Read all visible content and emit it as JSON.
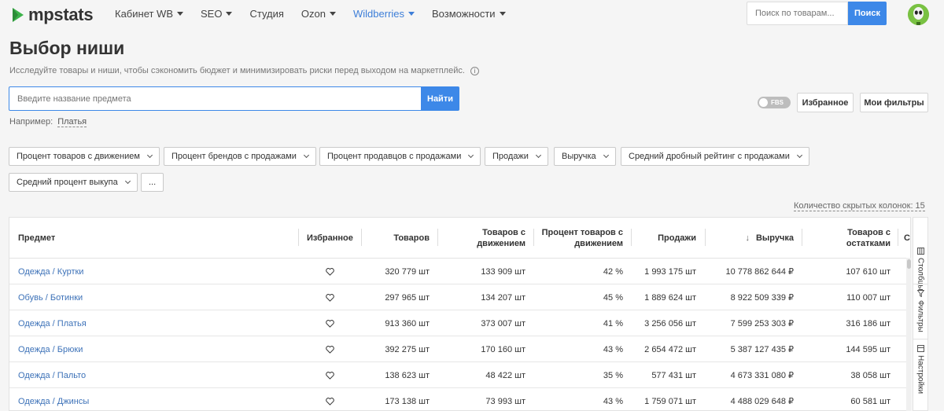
{
  "nav": {
    "logo": "mpstats",
    "items": [
      {
        "label": "Кабинет WB",
        "caret": true,
        "active": false
      },
      {
        "label": "SEO",
        "caret": true,
        "active": false
      },
      {
        "label": "Студия",
        "caret": false,
        "active": false
      },
      {
        "label": "Ozon",
        "caret": true,
        "active": false
      },
      {
        "label": "Wildberries",
        "caret": true,
        "active": true
      },
      {
        "label": "Возможности",
        "caret": true,
        "active": false
      }
    ],
    "search_placeholder": "Поиск по товарам...",
    "search_button": "Поиск"
  },
  "page": {
    "title": "Выбор ниши",
    "subtitle": "Исследуйте товары и ниши, чтобы сэкономить бюджет и минимизировать риски перед выходом на маркетплейс.",
    "info_icon": "i",
    "subject_placeholder": "Введите название предмета",
    "find_button": "Найти",
    "example_label": "Например:",
    "example_link": "Платья",
    "fbs_label": "FBS",
    "favorites_button": "Избранное",
    "my_filters_button": "Мои фильтры",
    "hidden_columns": "Количество скрытых колонок:  15"
  },
  "filters": [
    "Процент товаров с движением",
    "Процент брендов с продажами",
    "Процент продавцов с продажами",
    "Продажи",
    "Выручка",
    "Средний дробный рейтинг с продажами",
    "Средний процент выкупа",
    "..."
  ],
  "table": {
    "headers": {
      "subject": "Предмет",
      "favorite": "Избранное",
      "products": "Товаров",
      "products_moving": "Товаров с движением",
      "pct_moving": "Процент товаров с движением",
      "sales": "Продажи",
      "revenue": "Выручка",
      "products_stock": "Товаров с остатками",
      "cut": "Су"
    },
    "sort_arrow": "↓",
    "rows": [
      {
        "subject": "Одежда / Куртки",
        "products": "320 779 шт",
        "products_moving": "133 909 шт",
        "pct_moving": "42 %",
        "sales": "1 993 175 шт",
        "revenue": "10 778 862 644 ₽",
        "products_stock": "107 610 шт"
      },
      {
        "subject": "Обувь / Ботинки",
        "products": "297 965 шт",
        "products_moving": "134 207 шт",
        "pct_moving": "45 %",
        "sales": "1 889 624 шт",
        "revenue": "8 922 509 339 ₽",
        "products_stock": "110 007 шт"
      },
      {
        "subject": "Одежда / Платья",
        "products": "913 360 шт",
        "products_moving": "373 007 шт",
        "pct_moving": "41 %",
        "sales": "3 256 056 шт",
        "revenue": "7 599 253 303 ₽",
        "products_stock": "316 186 шт"
      },
      {
        "subject": "Одежда / Брюки",
        "products": "392 275 шт",
        "products_moving": "170 160 шт",
        "pct_moving": "43 %",
        "sales": "2 654 472 шт",
        "revenue": "5 387 127 435 ₽",
        "products_stock": "144 595 шт"
      },
      {
        "subject": "Одежда / Пальто",
        "products": "138 623 шт",
        "products_moving": "48 422 шт",
        "pct_moving": "35 %",
        "sales": "577 431 шт",
        "revenue": "4 673 331 080 ₽",
        "products_stock": "38 058 шт"
      },
      {
        "subject": "Одежда / Джинсы",
        "products": "173 138 шт",
        "products_moving": "73 993 шт",
        "pct_moving": "43 %",
        "sales": "1 759 071 шт",
        "revenue": "4 488 029 648 ₽",
        "products_stock": "60 581 шт"
      }
    ]
  },
  "side_panel": {
    "columns": "Столбцы",
    "filters": "Фильтры",
    "settings": "Настройки"
  },
  "colors": {
    "accent": "#3d88e8",
    "link": "#3d72b8",
    "logo_green": "#3cb24a"
  }
}
